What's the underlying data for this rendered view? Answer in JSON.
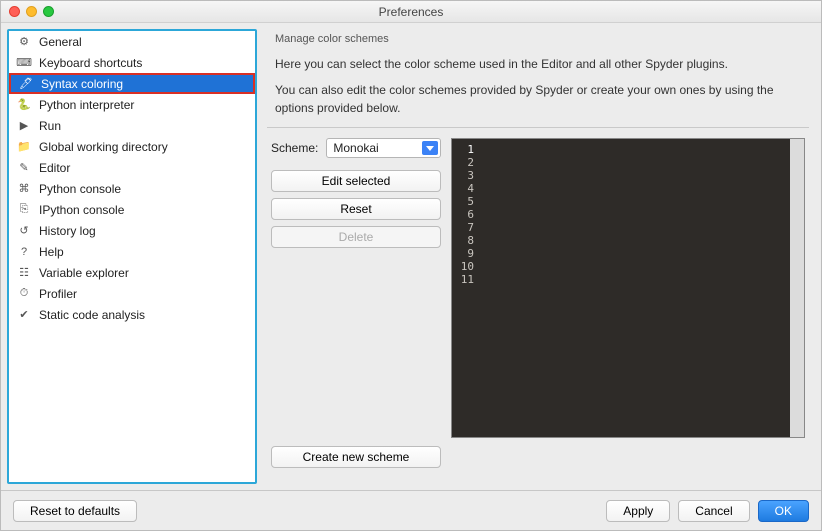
{
  "window": {
    "title": "Preferences"
  },
  "sidebar": {
    "items": [
      {
        "label": "General",
        "icon": "⚙"
      },
      {
        "label": "Keyboard shortcuts",
        "icon": "⌨"
      },
      {
        "label": "Syntax coloring",
        "icon": "🖊"
      },
      {
        "label": "Python interpreter",
        "icon": "🐍"
      },
      {
        "label": "Run",
        "icon": "▶"
      },
      {
        "label": "Global working directory",
        "icon": "📁"
      },
      {
        "label": "Editor",
        "icon": "✎"
      },
      {
        "label": "Python console",
        "icon": "⌘"
      },
      {
        "label": "IPython console",
        "icon": "⎘"
      },
      {
        "label": "History log",
        "icon": "↺"
      },
      {
        "label": "Help",
        "icon": "?"
      },
      {
        "label": "Variable explorer",
        "icon": "☷"
      },
      {
        "label": "Profiler",
        "icon": "⏱"
      },
      {
        "label": "Static code analysis",
        "icon": "✔"
      }
    ],
    "selected_index": 2
  },
  "main": {
    "group_title": "Manage color schemes",
    "intro_line1": "Here you can select the color scheme used in the Editor and all other Spyder plugins.",
    "intro_line2": "You can also edit the color schemes provided by Spyder or create your own ones by using the options provided below.",
    "scheme_label": "Scheme:",
    "scheme_value": "Monokai",
    "buttons": {
      "edit": "Edit selected",
      "reset": "Reset",
      "delete": "Delete",
      "create": "Create new scheme"
    },
    "preview": {
      "lines": [
        "1",
        "2",
        "3",
        "4",
        "5",
        "6",
        "7",
        "8",
        "9",
        "10",
        "11"
      ],
      "current_line_index": 0
    }
  },
  "footer": {
    "reset": "Reset to defaults",
    "apply": "Apply",
    "cancel": "Cancel",
    "ok": "OK"
  }
}
